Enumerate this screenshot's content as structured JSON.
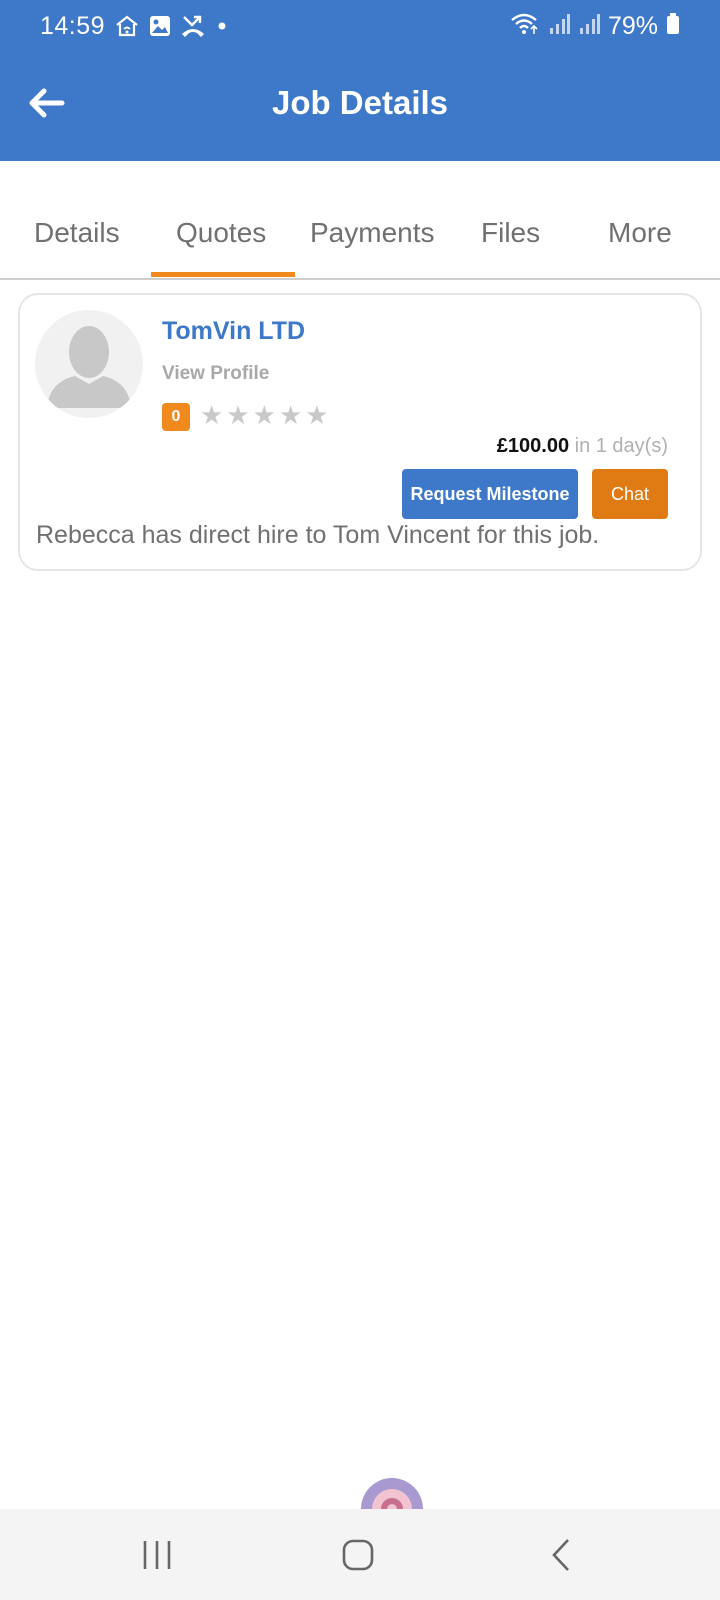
{
  "status_bar": {
    "time": "14:59",
    "battery_percent": "79%",
    "icons_left": [
      "home-wifi-icon",
      "gallery-icon",
      "missed-call-icon",
      "notification-dot-icon"
    ],
    "icons_right": [
      "wifi-icon",
      "signal-icon",
      "signal-icon",
      "battery-icon"
    ]
  },
  "app_bar": {
    "title": "Job Details",
    "back_icon": "arrow-left-icon",
    "background": "#3d78c9"
  },
  "tabs": {
    "items": [
      {
        "label": "Details",
        "active": false
      },
      {
        "label": "Quotes",
        "active": true
      },
      {
        "label": "Payments",
        "active": false
      },
      {
        "label": "Files",
        "active": false
      },
      {
        "label": "More",
        "active": false
      }
    ],
    "active_color": "#f08a1e"
  },
  "quote": {
    "company": "TomVin LTD",
    "view_profile": "View Profile",
    "rating_count": "0",
    "stars_filled": 0,
    "stars_total": 5,
    "price": "£100.00",
    "duration": "in 1 day(s)",
    "request_milestone_label": "Request Milestone",
    "chat_label": "Chat",
    "note": "Rebecca has direct hire to Tom Vincent for this job."
  },
  "colors": {
    "primary": "#3d78c9",
    "accent": "#f08a1e",
    "chat_button": "#e07a12"
  },
  "nav_bar": {
    "buttons": [
      "recent-apps-icon",
      "home-icon",
      "back-icon"
    ]
  }
}
